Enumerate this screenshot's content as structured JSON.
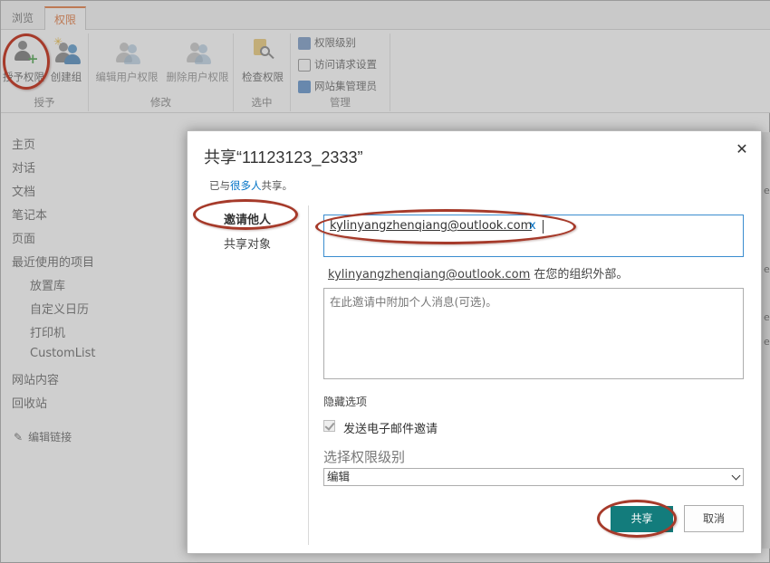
{
  "tabs": [
    {
      "label": "浏览"
    },
    {
      "label": "权限"
    }
  ],
  "ribbon": {
    "grant_label": "授予权限",
    "create_group_label": "创建组",
    "group_grant": "授予",
    "edit_user_perm": "编辑用户权限",
    "delete_user_perm": "删除用户权限",
    "group_modify": "修改",
    "check_perm": "检查权限",
    "group_check": "选中",
    "perm_levels": "权限级别",
    "access_request": "访问请求设置",
    "site_admins": "网站集管理员",
    "group_manage": "管理"
  },
  "sidenav": {
    "items": [
      "主页",
      "对话",
      "文档",
      "笔记本",
      "页面",
      "最近使用的项目"
    ],
    "subitems": [
      "放置库",
      "自定义日历",
      "打印机",
      "CustomList"
    ],
    "items2": [
      "网站内容",
      "回收站"
    ],
    "edit_links": "编辑链接"
  },
  "dialog": {
    "title": "共享“11123123_2333”",
    "shared_prefix": "已与",
    "shared_link": "很多人",
    "shared_suffix": "共享。",
    "nav_invite": "邀请他人",
    "nav_shared_with": "共享对象",
    "invitee_email": "kylinyangzhenqiang@outlook.com",
    "remove_chip": "x",
    "external_email": "kylinyangzhenqiang@outlook.com",
    "external_note": "在您的组织外部。",
    "message_placeholder": "在此邀请中附加个人消息(可选)。",
    "hide_options": "隐藏选项",
    "send_email_label": "发送电子邮件邀请",
    "send_email_checked": true,
    "permission_label": "选择权限级别",
    "permission_value": "编辑",
    "share_button": "共享",
    "cancel_button": "取消",
    "close_icon": "close-icon"
  },
  "colors": {
    "accent": "#e06b2c",
    "share_button": "#137c7c",
    "link": "#0072c6",
    "annotation": "#a63a2a"
  },
  "right_edge_text": [
    "e",
    "e",
    "e",
    "e"
  ]
}
